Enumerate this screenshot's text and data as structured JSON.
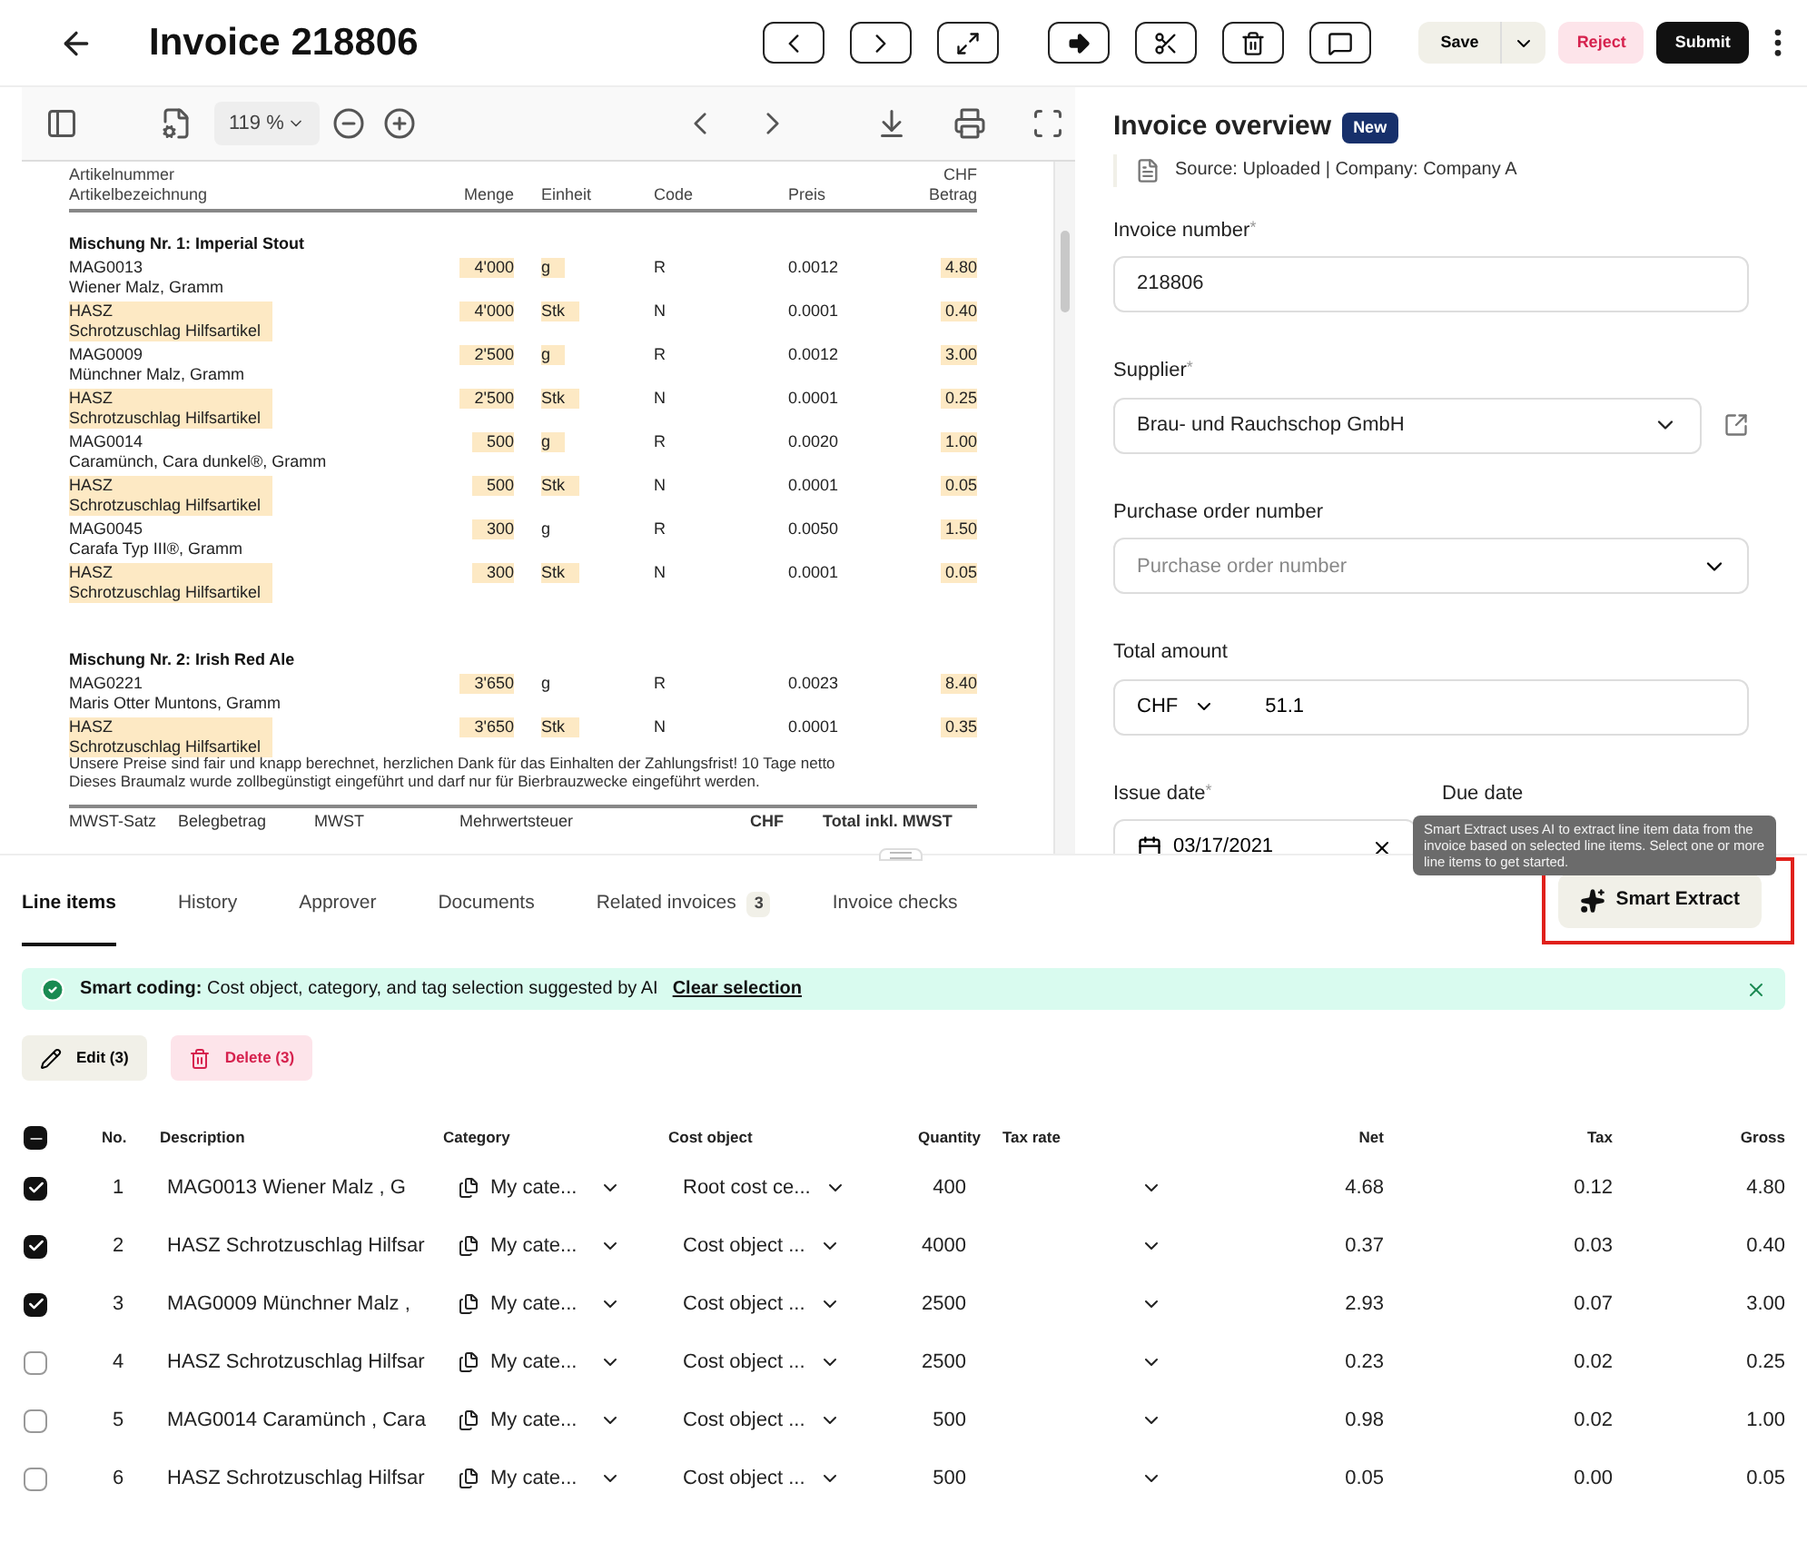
{
  "header": {
    "title": "Invoice 218806",
    "save": "Save",
    "reject": "Reject",
    "submit": "Submit"
  },
  "pdf_viewer": {
    "zoom": "119 %"
  },
  "document": {
    "top_label": "Artikelnummer",
    "currency": "CHF",
    "columns": [
      "Artikelbezeichnung",
      "Menge",
      "Einheit",
      "Code",
      "Preis",
      "Betrag"
    ],
    "groups": [
      {
        "title": "Mischung Nr. 1: Imperial Stout",
        "items": [
          {
            "number": "MAG0013",
            "name": "Wiener Malz, Gramm",
            "quantity": "4'000",
            "unit": "g",
            "code": "R",
            "price": "0.0012",
            "amount": "4.80",
            "highlighted": false,
            "unit_highlighted": true
          },
          {
            "number": "HASZ",
            "name": "Schrotzuschlag  Hilfsartikel",
            "quantity": "4'000",
            "unit": "Stk",
            "code": "N",
            "price": "0.0001",
            "amount": "0.40",
            "highlighted": true,
            "unit_highlighted": true
          },
          {
            "number": "MAG0009",
            "name": "Münchner Malz, Gramm",
            "quantity": "2'500",
            "unit": "g",
            "code": "R",
            "price": "0.0012",
            "amount": "3.00",
            "highlighted": false,
            "unit_highlighted": true
          },
          {
            "number": "HASZ",
            "name": "Schrotzuschlag  Hilfsartikel",
            "quantity": "2'500",
            "unit": "Stk",
            "code": "N",
            "price": "0.0001",
            "amount": "0.25",
            "highlighted": true,
            "unit_highlighted": true
          },
          {
            "number": "MAG0014",
            "name": "Caramünch, Cara dunkel®, Gramm",
            "quantity": "500",
            "unit": "g",
            "code": "R",
            "price": "0.0020",
            "amount": "1.00",
            "highlighted": false,
            "unit_highlighted": true
          },
          {
            "number": "HASZ",
            "name": "Schrotzuschlag  Hilfsartikel",
            "quantity": "500",
            "unit": "Stk",
            "code": "N",
            "price": "0.0001",
            "amount": "0.05",
            "highlighted": true,
            "unit_highlighted": true
          },
          {
            "number": "MAG0045",
            "name": "Carafa Typ III®, Gramm",
            "quantity": "300",
            "unit": "g",
            "code": "R",
            "price": "0.0050",
            "amount": "1.50",
            "highlighted": false,
            "unit_highlighted": false
          },
          {
            "number": "HASZ",
            "name": "Schrotzuschlag  Hilfsartikel",
            "quantity": "300",
            "unit": "Stk",
            "code": "N",
            "price": "0.0001",
            "amount": "0.05",
            "highlighted": true,
            "unit_highlighted": true
          }
        ]
      },
      {
        "title": "Mischung Nr. 2: Irish Red Ale",
        "items": [
          {
            "number": "MAG0221",
            "name": "Maris Otter Muntons, Gramm",
            "quantity": "3'650",
            "unit": "g",
            "code": "R",
            "price": "0.0023",
            "amount": "8.40",
            "highlighted": false,
            "unit_highlighted": false
          },
          {
            "number": "HASZ",
            "name": "Schrotzuschlag  Hilfsartikel",
            "quantity": "3'650",
            "unit": "Stk",
            "code": "N",
            "price": "0.0001",
            "amount": "0.35",
            "highlighted": true,
            "unit_highlighted": true
          }
        ]
      }
    ],
    "notes": [
      "Unsere Preise sind fair und knapp berechnet, herzlichen Dank für das Einhalten der Zahlungsfrist! 10 Tage netto",
      "Dieses Braumalz wurde zollbegünstigt eingeführt und darf nur für  Bierbrauzwecke eingeführt werden."
    ],
    "summary_columns": [
      "MWST-Satz",
      "Belegbetrag",
      "MWST",
      "Mehrwertsteuer",
      "CHF",
      "Total inkl. MWST"
    ]
  },
  "overview": {
    "title": "Invoice overview",
    "badge": "New",
    "source": "Source: Uploaded | Company: Company A",
    "invoice_number": {
      "label": "Invoice number",
      "mark": "*",
      "value": "218806"
    },
    "supplier": {
      "label": "Supplier",
      "mark": "*",
      "value": "Brau- und Rauchschop GmbH"
    },
    "purchase_order": {
      "label": "Purchase order number",
      "placeholder": "Purchase order number"
    },
    "total_amount": {
      "label": "Total amount",
      "currency": "CHF",
      "value": "51.1"
    },
    "issue_date": {
      "label": "Issue date",
      "mark": "*",
      "value": "03/17/2021"
    },
    "due_date": {
      "label": "Due date"
    }
  },
  "tooltip": "Smart Extract uses AI to extract line item data from the invoice based on selected line items. Select one or more line items to get started.",
  "tabs": [
    {
      "label": "Line items",
      "selected": true
    },
    {
      "label": "History",
      "selected": false
    },
    {
      "label": "Approver",
      "selected": false
    },
    {
      "label": "Documents",
      "selected": false
    },
    {
      "label": "Related invoices",
      "count": "3",
      "selected": false
    },
    {
      "label": "Invoice checks",
      "selected": false
    }
  ],
  "smart_extract": "Smart Extract",
  "banner": {
    "text": "**Smart coding:** Cost object, category, and tag selection suggested by AI",
    "link": "Clear selection"
  },
  "actions": {
    "edit": "Edit (3)",
    "delete": "Delete (3)"
  },
  "table": {
    "select_all": {
      "indeterminate": true
    },
    "columns": [
      "No.",
      "Description",
      "Category",
      "Cost object",
      "Quantity",
      "Tax rate",
      "Net",
      "Tax",
      "Gross"
    ],
    "rows": [
      {
        "checked": true,
        "no": "1",
        "description": "MAG0013 Wiener Malz , G",
        "category": "My cate...",
        "cost_object": "Root cost ce...",
        "quantity": "400",
        "net": "4.68",
        "tax": "0.12",
        "gross": "4.80"
      },
      {
        "checked": true,
        "no": "2",
        "description": "HASZ Schrotzuschlag Hilfsar",
        "category": "My cate...",
        "cost_object": "Cost object ...",
        "quantity": "4000",
        "net": "0.37",
        "tax": "0.03",
        "gross": "0.40"
      },
      {
        "checked": true,
        "no": "3",
        "description": "MAG0009 Münchner Malz ,",
        "category": "My cate...",
        "cost_object": "Cost object ...",
        "quantity": "2500",
        "net": "2.93",
        "tax": "0.07",
        "gross": "3.00"
      },
      {
        "checked": false,
        "no": "4",
        "description": "HASZ Schrotzuschlag Hilfsar",
        "category": "My cate...",
        "cost_object": "Cost object ...",
        "quantity": "2500",
        "net": "0.23",
        "tax": "0.02",
        "gross": "0.25"
      },
      {
        "checked": false,
        "no": "5",
        "description": "MAG0014 Caramünch , Cara",
        "category": "My cate...",
        "cost_object": "Cost object ...",
        "quantity": "500",
        "net": "0.98",
        "tax": "0.02",
        "gross": "1.00"
      },
      {
        "checked": false,
        "no": "6",
        "description": "HASZ Schrotzuschlag Hilfsar",
        "category": "My cate...",
        "cost_object": "Cost object ...",
        "quantity": "500",
        "net": "0.05",
        "tax": "0.00",
        "gross": "0.05"
      }
    ]
  }
}
